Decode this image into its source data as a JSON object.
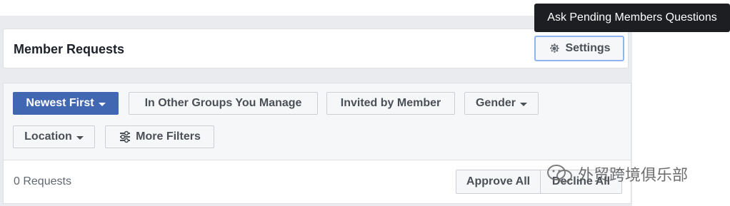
{
  "header": {
    "title": "Member Requests",
    "settings_label": "Settings"
  },
  "tooltip": {
    "text": "Ask Pending Members Questions"
  },
  "filters": {
    "newest_first": "Newest First",
    "other_groups": "In Other Groups You Manage",
    "invited_by_member": "Invited by Member",
    "gender": "Gender",
    "location": "Location",
    "more_filters": "More Filters"
  },
  "results": {
    "count_text": "0 Requests",
    "approve_all": "Approve All",
    "decline_all": "Decline All"
  },
  "watermark": {
    "text": "外贸跨境俱乐部"
  },
  "colors": {
    "primary": "#4267b2",
    "tooltip_bg": "#1c1e21",
    "focus_ring": "#8fb4f0"
  },
  "icons": [
    "gear-icon",
    "caret-down-icon",
    "sliders-icon",
    "wechat-logo-icon"
  ]
}
